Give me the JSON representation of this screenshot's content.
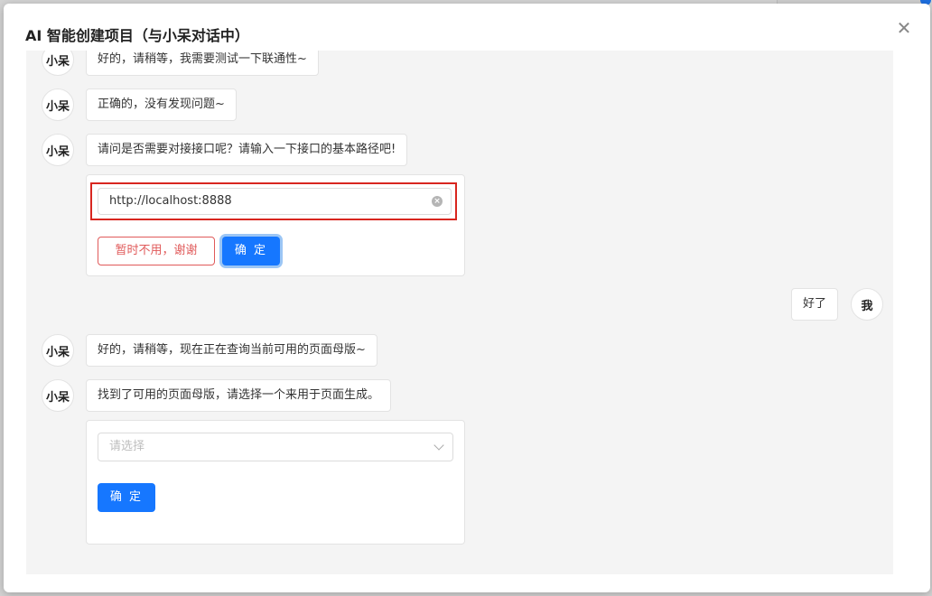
{
  "dialog": {
    "title": "AI 智能创建项目（与小呆对话中）",
    "close_glyph": "✕"
  },
  "bot_name": "小呆",
  "user_name": "我",
  "messages": [
    {
      "from": "bot",
      "text": "好的，请稍等，我需要测试一下联通性~"
    },
    {
      "from": "bot",
      "text": "正确的，没有发现问题~"
    },
    {
      "from": "bot",
      "text": "请问是否需要对接接口呢？请输入一下接口的基本路径吧!"
    },
    {
      "from": "user",
      "text": "好了"
    },
    {
      "from": "bot",
      "text": "好的，请稍等，现在正在查询当前可用的页面母版~"
    },
    {
      "from": "bot",
      "text": "找到了可用的页面母版，请选择一个来用于页面生成。"
    }
  ],
  "api_form": {
    "url_value": "http://localhost:8888",
    "decline_label": "暂时不用，谢谢",
    "confirm_label": "确 定"
  },
  "template_form": {
    "select_placeholder": "请选择",
    "confirm_label": "确 定"
  },
  "colors": {
    "primary": "#1677ff",
    "danger": "#e05a5a",
    "highlight": "#d8261f"
  }
}
